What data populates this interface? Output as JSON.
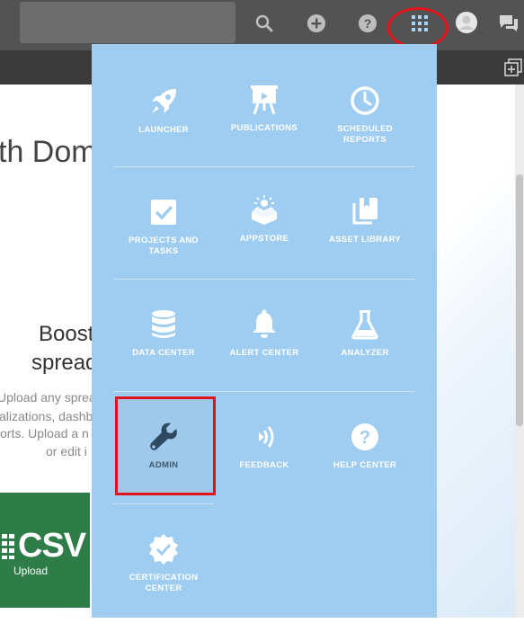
{
  "background": {
    "title": "th Dom",
    "heading_line1": "Boost",
    "heading_line2": "spread",
    "desc_line1": "Upload any sprea",
    "desc_line2": "alizations, dashb",
    "desc_line3": "orts. Upload a n",
    "desc_line4": "or edit i",
    "csv_label": "CSV",
    "csv_sublabel": "Upload"
  },
  "menu": {
    "items": [
      {
        "label": "LAUNCHER",
        "icon": "rocket-icon"
      },
      {
        "label": "PUBLICATIONS",
        "icon": "presentation-icon"
      },
      {
        "label": "SCHEDULED REPORTS",
        "icon": "clock-icon"
      },
      {
        "label": "PROJECTS AND TASKS",
        "icon": "checkbox-icon"
      },
      {
        "label": "APPSTORE",
        "icon": "appstore-icon"
      },
      {
        "label": "ASSET LIBRARY",
        "icon": "library-icon"
      },
      {
        "label": "DATA CENTER",
        "icon": "database-icon"
      },
      {
        "label": "ALERT CENTER",
        "icon": "bell-icon"
      },
      {
        "label": "ANALYZER",
        "icon": "flask-icon"
      },
      {
        "label": "ADMIN",
        "icon": "wrench-icon"
      },
      {
        "label": "FEEDBACK",
        "icon": "feedback-icon"
      },
      {
        "label": "HELP CENTER",
        "icon": "help-icon"
      },
      {
        "label": "CERTIFICATION CENTER",
        "icon": "badge-icon"
      }
    ]
  },
  "colors": {
    "panel": "#9fcdf1",
    "highlight": "#e1141b",
    "topbar": "#535353"
  }
}
